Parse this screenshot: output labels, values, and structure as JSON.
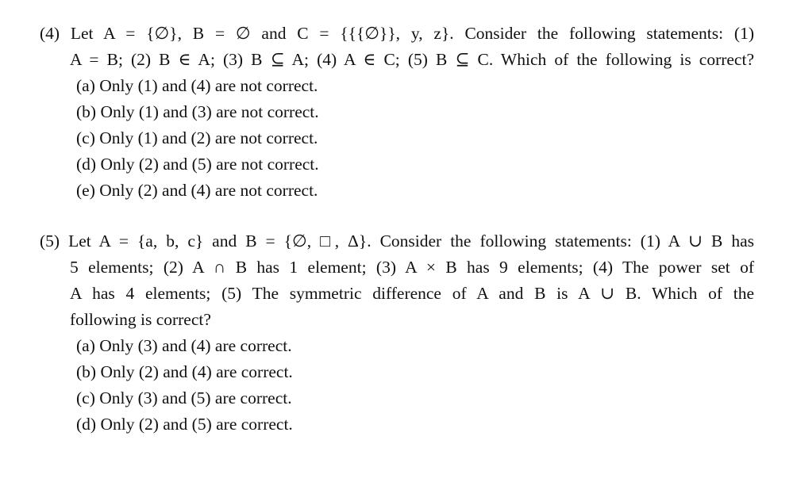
{
  "problems": [
    {
      "number": "(4)",
      "lines": [
        "(4) Let A = {∅}, B = ∅ and C = {{{∅}}, y, z}. Consider the following statements: (1)",
        "A = B; (2) B ∈ A; (3) B ⊆ A; (4) A ∈ C; (5) B ⊆ C. Which of the following is correct?"
      ],
      "options": [
        "(a) Only (1) and (4) are not correct.",
        "(b) Only (1) and (3) are not correct.",
        "(c) Only (1) and (2) are not correct.",
        "(d) Only (2) and (5) are not correct.",
        "(e) Only (2) and (4) are not correct."
      ]
    },
    {
      "number": "(5)",
      "lines": [
        "(5) Let A = {a, b, c} and B = {∅, □, Δ}. Consider the following statements: (1) A ∪ B has",
        "5 elements; (2) A ∩ B has 1 element; (3) A × B has 9 elements; (4) The power set of",
        "A has 4 elements; (5) The symmetric difference of A and B is A ∪ B. Which of the",
        "following is correct?"
      ],
      "options": [
        "(a) Only (3) and (4) are correct.",
        "(b) Only (2) and (4) are correct.",
        "(c) Only (3) and (5) are correct.",
        "(d) Only (2) and (5) are correct."
      ]
    }
  ]
}
